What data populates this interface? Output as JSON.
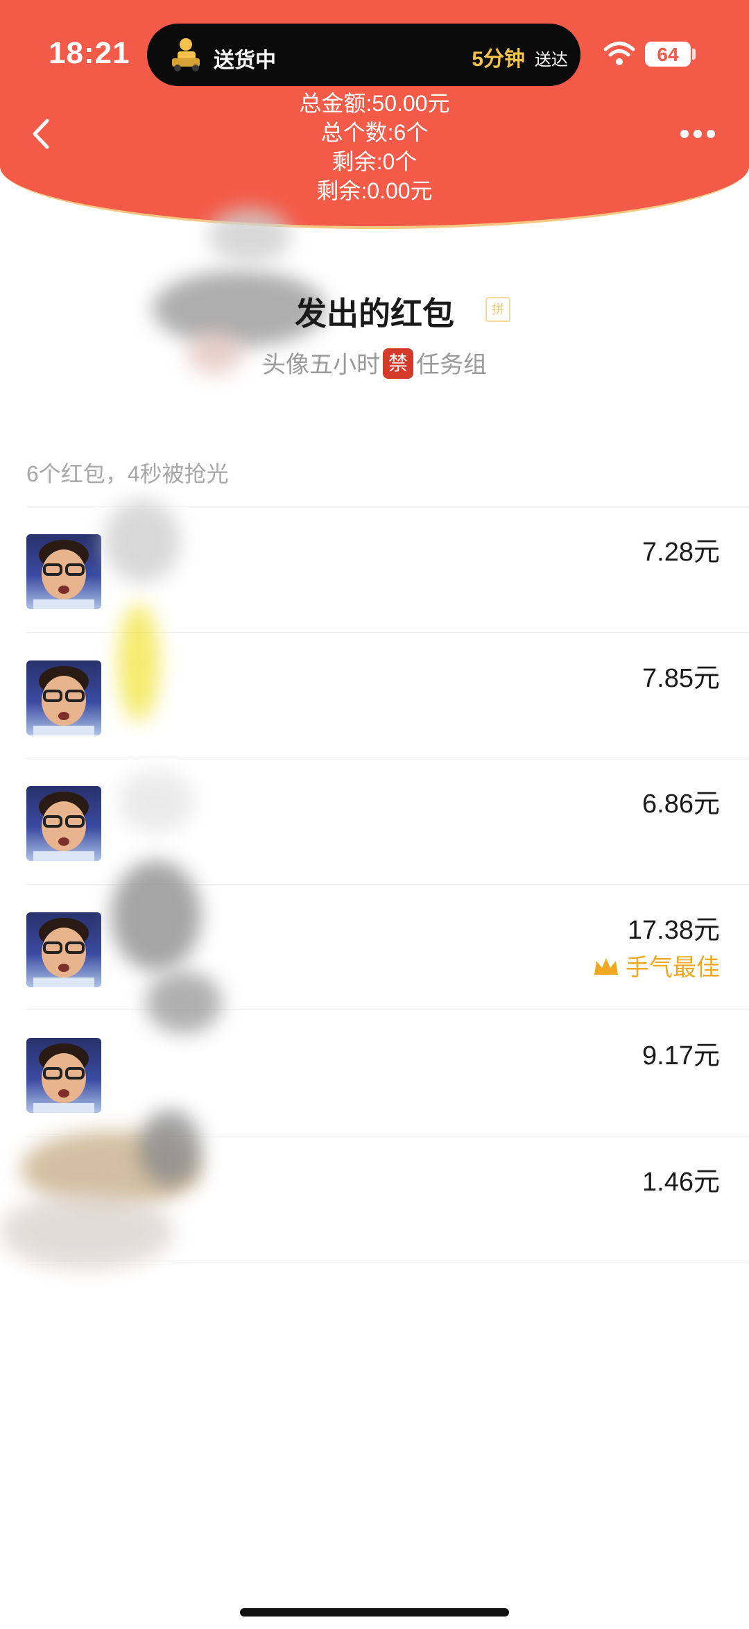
{
  "status_bar": {
    "time": "18:21",
    "delivery_label": "送货中",
    "delivery_eta": "5分钟",
    "delivery_arrive": "送达",
    "battery": "64"
  },
  "summary": {
    "total_amount": "总金额:50.00元",
    "total_count": "总个数:6个",
    "remaining_count": "剩余:0个",
    "remaining_amount": "剩余:0.00元"
  },
  "sender": {
    "title": "发出的红包",
    "tag": "拼",
    "group_prefix": "头像五小时",
    "group_badge": "禁",
    "group_suffix": "任务组"
  },
  "count_line": "6个红包，4秒被抢光",
  "list": [
    {
      "amount": "7.28元",
      "best": ""
    },
    {
      "amount": "7.85元",
      "best": ""
    },
    {
      "amount": "6.86元",
      "best": ""
    },
    {
      "amount": "17.38元",
      "best": "手气最佳"
    },
    {
      "amount": "9.17元",
      "best": ""
    },
    {
      "amount": "1.46元",
      "best": ""
    }
  ],
  "colors": {
    "header": "#f45a48",
    "header_border": "#f6c781",
    "best_luck": "#f0a820"
  },
  "icons": [
    "back-arrow-icon",
    "more-icon",
    "wifi-icon",
    "battery-icon",
    "crown-icon",
    "delivery-icon"
  ]
}
